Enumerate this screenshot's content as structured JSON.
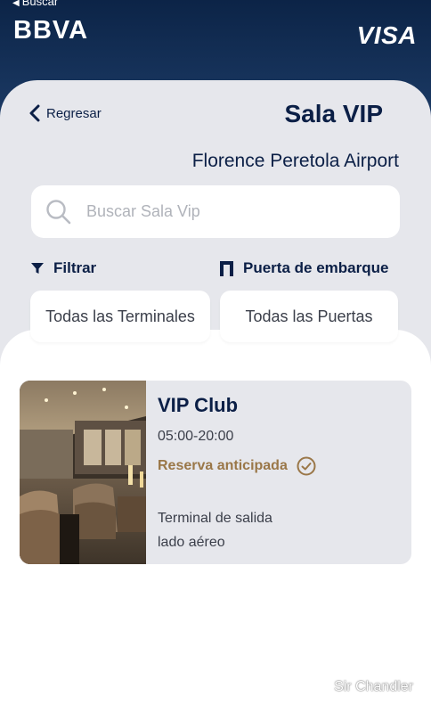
{
  "status_bar": {
    "back_label": "Buscar"
  },
  "brand": {
    "bank": "BBVA",
    "network": "VISA"
  },
  "header": {
    "back_label": "Regresar",
    "title": "Sala VIP"
  },
  "airport": "Florence Peretola Airport",
  "search": {
    "placeholder": "Buscar Sala Vip",
    "value": ""
  },
  "filters": {
    "filter_label": "Filtrar",
    "gate_label": "Puerta de embarque",
    "terminal_select": "Todas las Terminales",
    "gate_select": "Todas las Puertas"
  },
  "lounges": [
    {
      "name": "VIP Club",
      "hours": "05:00-20:00",
      "reservation": "Reserva anticipada",
      "terminal": "Terminal de salida",
      "side": "lado aéreo"
    }
  ],
  "watermark": "Sir Chandler",
  "colors": {
    "navy": "#0b1f46",
    "header_bg": "#0c2447",
    "accent_gold": "#9a7748",
    "panel_gray": "#e6e7ec"
  }
}
